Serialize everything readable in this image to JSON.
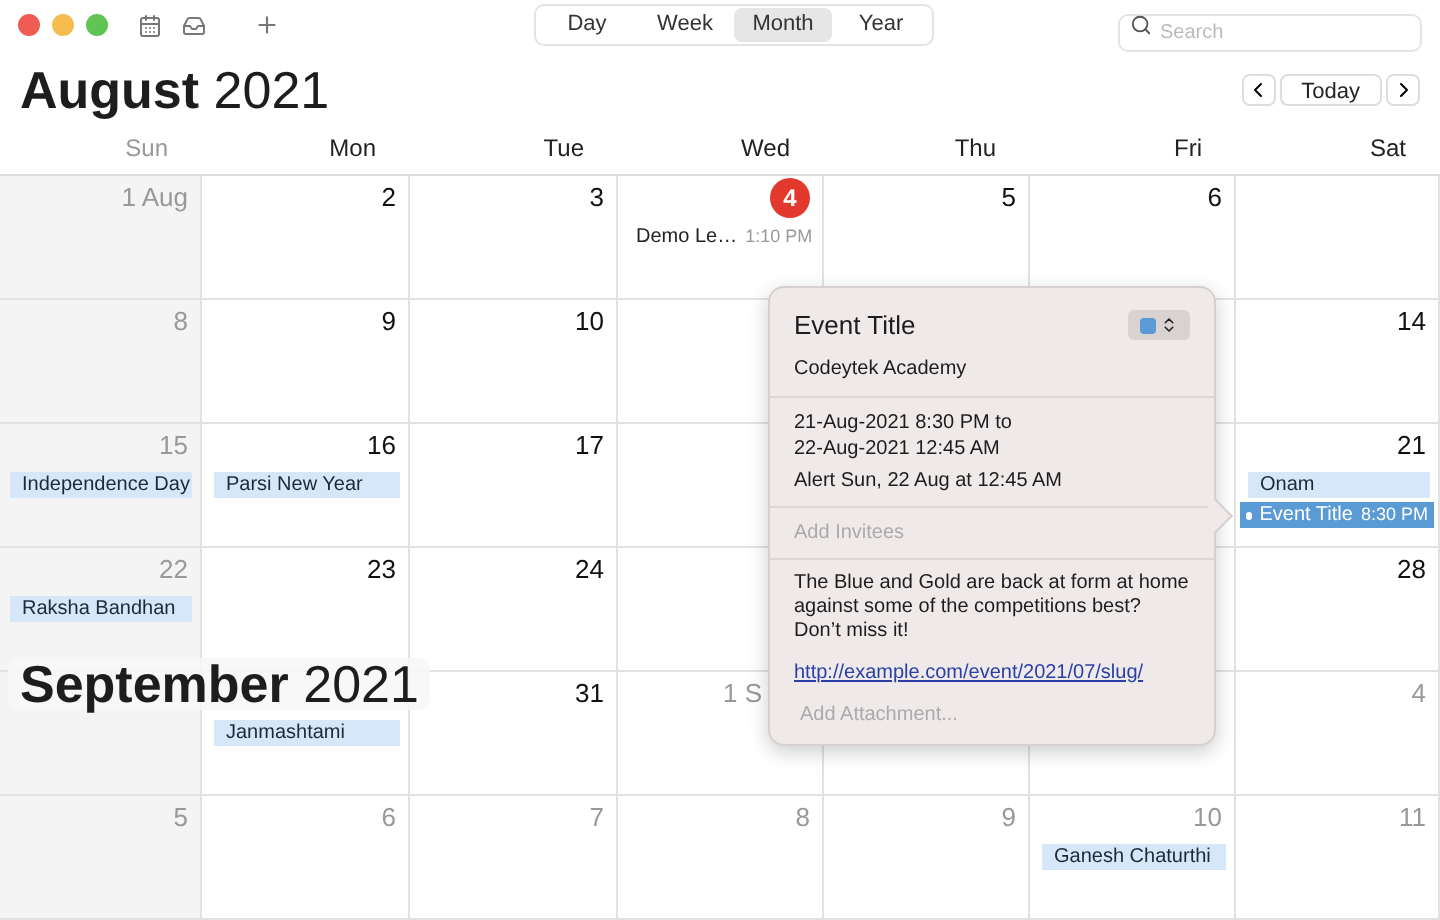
{
  "toolbar": {
    "views": [
      {
        "label": "Day",
        "selected": false
      },
      {
        "label": "Week",
        "selected": false
      },
      {
        "label": "Month",
        "selected": true
      },
      {
        "label": "Year",
        "selected": false
      }
    ],
    "search": {
      "placeholder": "Search"
    }
  },
  "header": {
    "month": "August",
    "year": "2021",
    "today_button": "Today"
  },
  "weekdays": [
    "Sun",
    "Mon",
    "Tue",
    "Wed",
    "Thu",
    "Fri",
    "Sat"
  ],
  "weeks": [
    {
      "days": [
        {
          "kind": "dated",
          "day": "1 Aug",
          "muted": true,
          "today": false
        },
        {
          "kind": "dated",
          "day": "2",
          "muted": false,
          "today": false
        },
        {
          "kind": "dated",
          "day": "3",
          "muted": false,
          "today": false
        },
        {
          "kind": "dated",
          "day": "4",
          "muted": false,
          "today": true,
          "events": [
            {
              "kind": "timed",
              "title": "Demo Le…",
              "time": "1:10 PM",
              "selected": false
            }
          ]
        },
        {
          "kind": "dated",
          "day": "5",
          "muted": false,
          "today": false
        },
        {
          "kind": "dated",
          "day": "6",
          "muted": false,
          "today": false
        },
        {
          "kind": "blank"
        }
      ]
    },
    {
      "days": [
        {
          "kind": "dated",
          "day": "8",
          "muted": true,
          "today": false
        },
        {
          "kind": "dated",
          "day": "9",
          "muted": false,
          "today": false
        },
        {
          "kind": "dated",
          "day": "10",
          "muted": false,
          "today": false
        },
        {
          "kind": "blank"
        },
        {
          "kind": "covered"
        },
        {
          "kind": "blank"
        },
        {
          "kind": "dated",
          "day": "14",
          "muted": false,
          "today": false
        }
      ]
    },
    {
      "days": [
        {
          "kind": "dated",
          "day": "15",
          "muted": true,
          "today": false,
          "events": [
            {
              "kind": "allday",
              "title": "Independence Day"
            }
          ]
        },
        {
          "kind": "dated",
          "day": "16",
          "muted": false,
          "today": false,
          "events": [
            {
              "kind": "allday",
              "title": "Parsi New Year"
            }
          ]
        },
        {
          "kind": "dated",
          "day": "17",
          "muted": false,
          "today": false
        },
        {
          "kind": "blank"
        },
        {
          "kind": "covered"
        },
        {
          "kind": "blank"
        },
        {
          "kind": "dated",
          "day": "21",
          "muted": false,
          "today": false,
          "events": [
            {
              "kind": "allday",
              "title": "Onam"
            },
            {
              "kind": "timed",
              "title": "Event Title",
              "time": "8:30 PM",
              "selected": true
            }
          ]
        }
      ]
    },
    {
      "days": [
        {
          "kind": "dated",
          "day": "22",
          "muted": true,
          "today": false,
          "events": [
            {
              "kind": "allday",
              "title": "Raksha Bandhan"
            }
          ]
        },
        {
          "kind": "dated",
          "day": "23",
          "muted": false,
          "today": false
        },
        {
          "kind": "dated",
          "day": "24",
          "muted": false,
          "today": false
        },
        {
          "kind": "blank"
        },
        {
          "kind": "covered"
        },
        {
          "kind": "blank"
        },
        {
          "kind": "dated",
          "day": "28",
          "muted": false,
          "today": false
        }
      ]
    },
    {
      "days": [
        {
          "kind": "blank"
        },
        {
          "kind": "blank",
          "events": [
            {
              "kind": "allday",
              "title": "Janmashtami"
            }
          ]
        },
        {
          "kind": "dated",
          "day": "31",
          "muted": false,
          "today": false
        },
        {
          "kind": "dated",
          "day": "1 S",
          "muted": true,
          "today": false
        },
        {
          "kind": "blank"
        },
        {
          "kind": "blank"
        },
        {
          "kind": "dated",
          "day": "4",
          "muted": true,
          "today": false
        }
      ]
    },
    {
      "days": [
        {
          "kind": "dated",
          "day": "5",
          "muted": true,
          "today": false
        },
        {
          "kind": "dated",
          "day": "6",
          "muted": true,
          "today": false
        },
        {
          "kind": "dated",
          "day": "7",
          "muted": true,
          "today": false
        },
        {
          "kind": "dated",
          "day": "8",
          "muted": true,
          "today": false
        },
        {
          "kind": "dated",
          "day": "9",
          "muted": true,
          "today": false
        },
        {
          "kind": "dated",
          "day": "10",
          "muted": true,
          "today": false,
          "events": [
            {
              "kind": "allday",
              "title": "Ganesh Chaturthi"
            }
          ]
        },
        {
          "kind": "dated",
          "day": "11",
          "muted": true,
          "today": false
        }
      ]
    }
  ],
  "month_overlay": {
    "month": "September",
    "year": "2021"
  },
  "popover": {
    "title": "Event Title",
    "calendar": "Codeytek Academy",
    "time_line_1": "21-Aug-2021 8:30 PM to",
    "time_line_2": "22-Aug-2021 12:45 AM",
    "alert": "Alert Sun, 22 Aug at 12:45 AM",
    "invitees_placeholder": "Add Invitees",
    "notes": "The Blue and Gold are back at form at home against some of the competitions best? Don’t miss it!",
    "url": "http://example.com/event/2021/07/slug/",
    "attachment_placeholder": "Add Attachment..."
  }
}
